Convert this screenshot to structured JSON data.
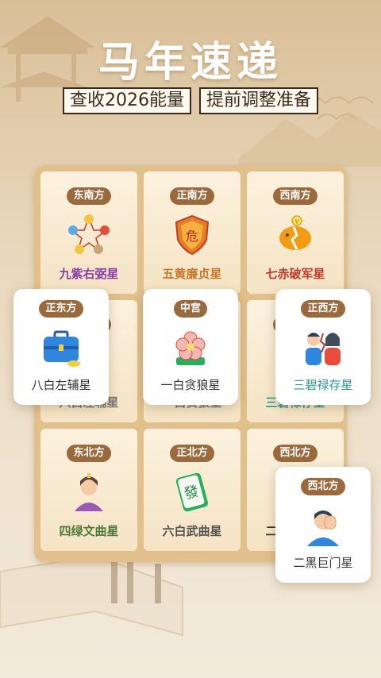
{
  "header": {
    "title": "马年速递",
    "subtitle_left": "查收2026能量",
    "subtitle_right": "提前调整准备"
  },
  "grid": [
    {
      "direction": "东南方",
      "star": "九紫右弼星",
      "star_color": "#8a3fa8",
      "icon": "five-elements-icon"
    },
    {
      "direction": "正南方",
      "star": "五黄廉贞星",
      "star_color": "#c7772a",
      "icon": "danger-shield-icon"
    },
    {
      "direction": "西南方",
      "star": "七赤破军星",
      "star_color": "#c0392b",
      "icon": "broken-piggy-bank-icon"
    },
    {
      "direction": "正东方",
      "star": "八白左辅星",
      "star_color": "#777777",
      "icon": "briefcase-icon"
    },
    {
      "direction": "中宫",
      "star": "一白贪狼星",
      "star_color": "#777777",
      "icon": "plum-blossom-icon"
    },
    {
      "direction": "正西方",
      "star": "三碧禄存星",
      "star_color": "#2a9d8f",
      "icon": "quarrel-couple-icon"
    },
    {
      "direction": "东北方",
      "star": "四绿文曲星",
      "star_color": "#4a7a3a",
      "icon": "scholar-woman-icon"
    },
    {
      "direction": "正北方",
      "star": "六白武曲星",
      "star_color": "#555555",
      "icon": "mahjong-tile-icon"
    },
    {
      "direction": "西北方",
      "star": "二黑巨门星",
      "star_color": "#333333",
      "icon": "sick-man-icon"
    }
  ],
  "cards": [
    {
      "direction": "正东方",
      "star": "八白左辅星",
      "icon": "briefcase-icon"
    },
    {
      "direction": "中宫",
      "star": "一白贪狼星",
      "icon": "plum-blossom-icon"
    },
    {
      "direction": "正西方",
      "star": "三碧禄存星",
      "icon": "quarrel-couple-icon",
      "star_color": "#2a9d8f"
    },
    {
      "direction": "西北方",
      "star": "二黑巨门星",
      "icon": "sick-man-icon"
    }
  ],
  "colors": {
    "pill": "#9a6a3c",
    "panel": "#e2c08c",
    "title": "#ffffff"
  }
}
